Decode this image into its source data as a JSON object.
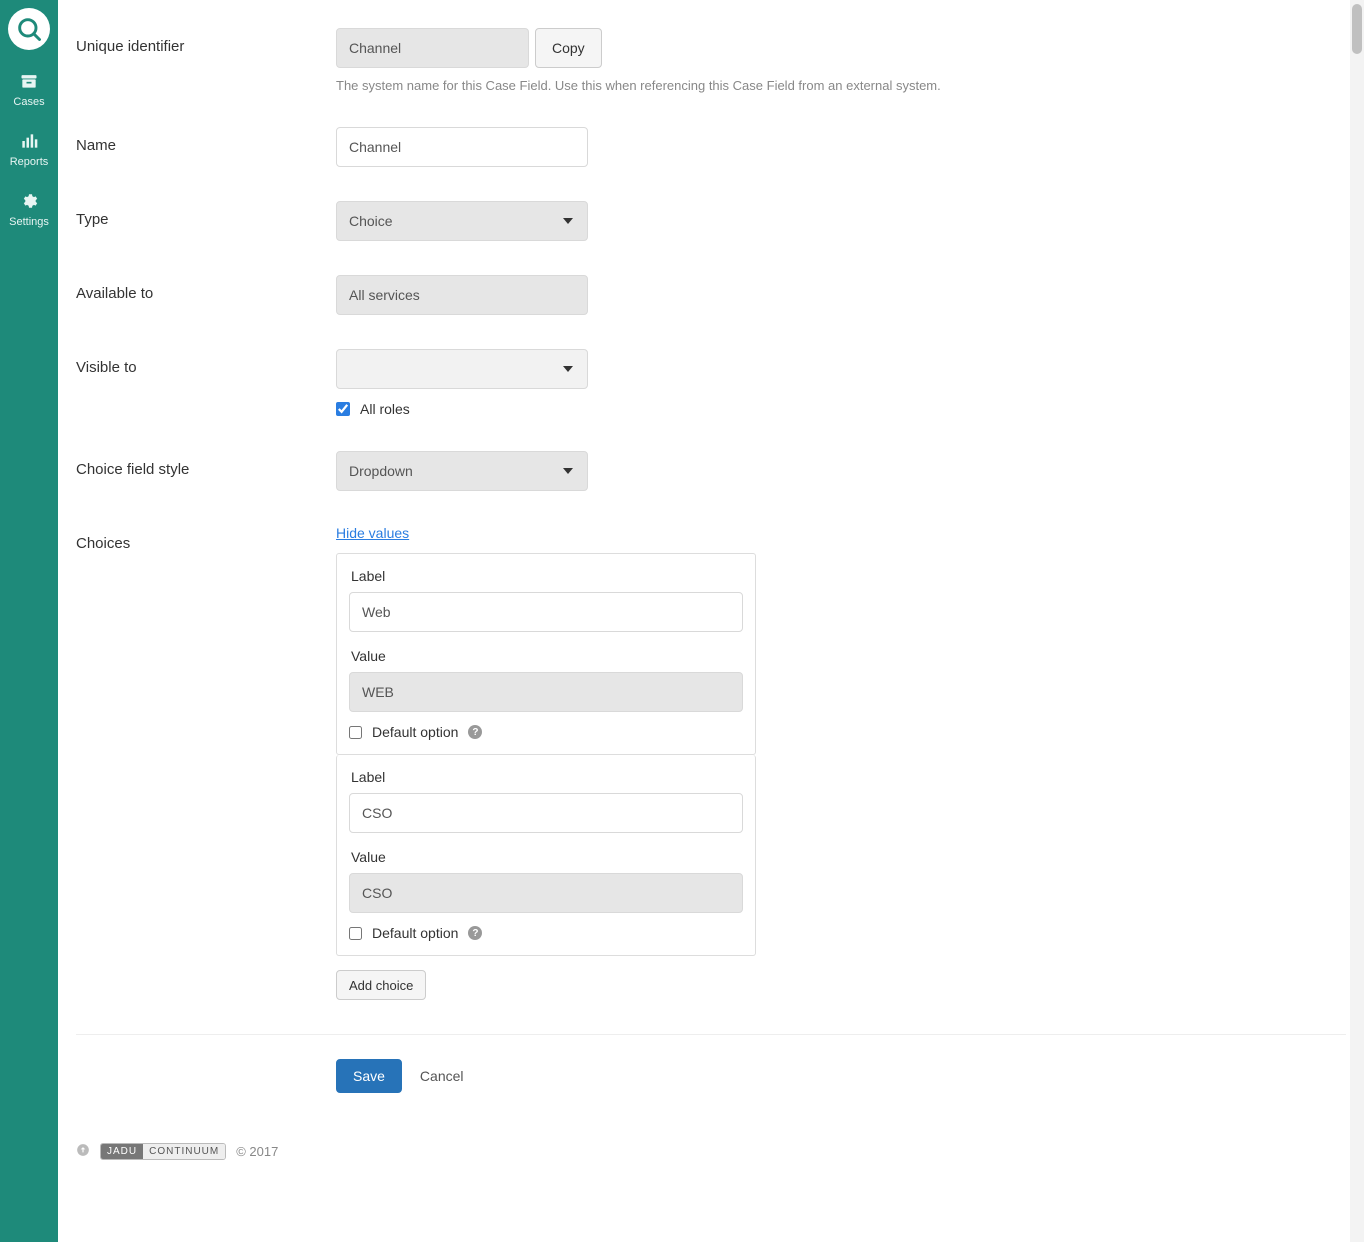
{
  "sidebar": {
    "items": [
      {
        "label": "Cases"
      },
      {
        "label": "Reports"
      },
      {
        "label": "Settings"
      }
    ]
  },
  "form": {
    "unique_id_label": "Unique identifier",
    "unique_id_value": "Channel",
    "copy_label": "Copy",
    "unique_id_help": "The system name for this Case Field. Use this when referencing this Case Field from an external system.",
    "name_label": "Name",
    "name_value": "Channel",
    "type_label": "Type",
    "type_value": "Choice",
    "available_label": "Available to",
    "available_value": "All services",
    "visible_label": "Visible to",
    "visible_value": "",
    "all_roles_label": "All roles",
    "style_label": "Choice field style",
    "style_value": "Dropdown",
    "choices_label": "Choices",
    "hide_values_label": "Hide values",
    "choice_label_text": "Label",
    "choice_value_text": "Value",
    "default_option_text": "Default option",
    "choices": [
      {
        "label": "Web",
        "value": "WEB",
        "default": false
      },
      {
        "label": "CSO",
        "value": "CSO",
        "default": false
      }
    ],
    "add_choice_label": "Add choice",
    "save_label": "Save",
    "cancel_label": "Cancel"
  },
  "footer": {
    "brand1": "JADU",
    "brand2": "CONTINUUM",
    "copyright": "© 2017"
  }
}
